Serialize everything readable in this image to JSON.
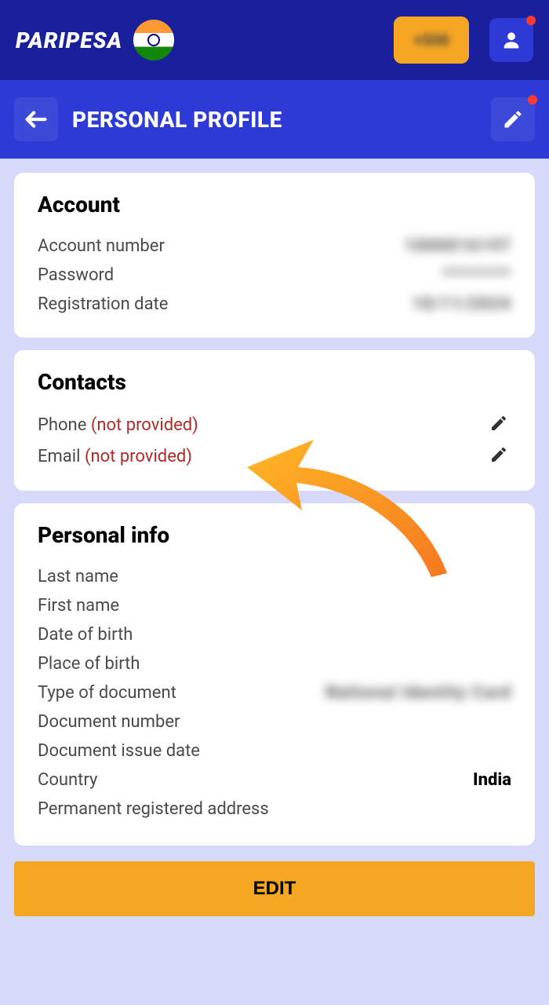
{
  "header": {
    "logo": "PARIPESA",
    "deposit_blur": "+500"
  },
  "subheader": {
    "page_title": "PERSONAL PROFILE"
  },
  "account": {
    "heading": "Account",
    "rows": {
      "number_label": "Account number",
      "number_value": "1000016197",
      "password_label": "Password",
      "password_value": "********",
      "regdate_label": "Registration date",
      "regdate_value": "10/11/2024"
    }
  },
  "contacts": {
    "heading": "Contacts",
    "phone_label": "Phone",
    "phone_status": "(not provided)",
    "email_label": "Email",
    "email_status": "(not provided)"
  },
  "personal": {
    "heading": "Personal info",
    "last_name": "Last name",
    "first_name": "First name",
    "dob": "Date of birth",
    "pob": "Place of birth",
    "doc_type_label": "Type of document",
    "doc_type_value": "National Identity Card",
    "doc_number": "Document number",
    "doc_issue": "Document issue date",
    "country_label": "Country",
    "country_value": "India",
    "address": "Permanent registered address"
  },
  "footer": {
    "edit_label": "EDIT"
  }
}
